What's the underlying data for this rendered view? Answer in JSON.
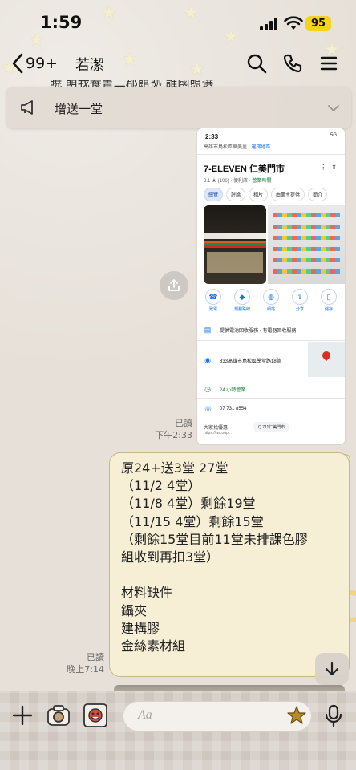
{
  "status_bar": {
    "time": "1:59",
    "battery": "95"
  },
  "header": {
    "back_count": "99+",
    "chat_name": "若潔"
  },
  "announcement": {
    "peek_text": "暁 萌我養書二郡館拠 誰國照選",
    "text": "增送一堂"
  },
  "shared_screenshot": {
    "status_time": "2:33",
    "status_right": "5G",
    "address": "高雄市鳥松區華美里 · ",
    "address_link": "選擇地區",
    "title": "7-ELEVEN 仁美門市",
    "rating": "3.1 ★ (106) · 便利店 · ",
    "rating_open": "營業時間",
    "tabs": [
      "總覽",
      "評論",
      "相片",
      "由業主提供",
      "簡介"
    ],
    "actions": [
      "致電",
      "規劃路線",
      "網站",
      "分享",
      "儲存"
    ],
    "rows": [
      {
        "icon": "▤",
        "text": "提供電池回收服務 · 有電器回收服務"
      },
      {
        "icon": "◉",
        "text": "833高雄市鳥松區學堂路18號"
      },
      {
        "icon": "◷",
        "text": "24 小時營業"
      },
      {
        "icon": "☏",
        "text": "07 731 8554"
      }
    ],
    "footer_title": "大家找優惠",
    "footer_url": "https://twcoup...",
    "footer_chip": "Q 711仁美門市"
  },
  "messages": {
    "screenshot_meta": {
      "read": "已讀",
      "time": "下午2:33"
    },
    "text_meta": {
      "read": "已讀",
      "time": "晚上7:14"
    },
    "bubble_lines": [
      "原24+送3堂 27堂",
      "（11/2 4堂）",
      "（11/8 4堂）剩餘19堂",
      "（11/15 4堂）剩餘15堂",
      "（剩餘15堂目前11堂未排課色膠",
      "組收到再扣3堂）",
      "",
      "材料缺件",
      "鑷夾",
      "建構膠",
      "金絲素材組"
    ]
  },
  "input": {
    "placeholder": "Aa"
  },
  "colors": {
    "bubble": "#f7eed6",
    "bubble_border": "#c9b887",
    "battery": "#f5d31d",
    "map_blue": "#1a73e8"
  }
}
